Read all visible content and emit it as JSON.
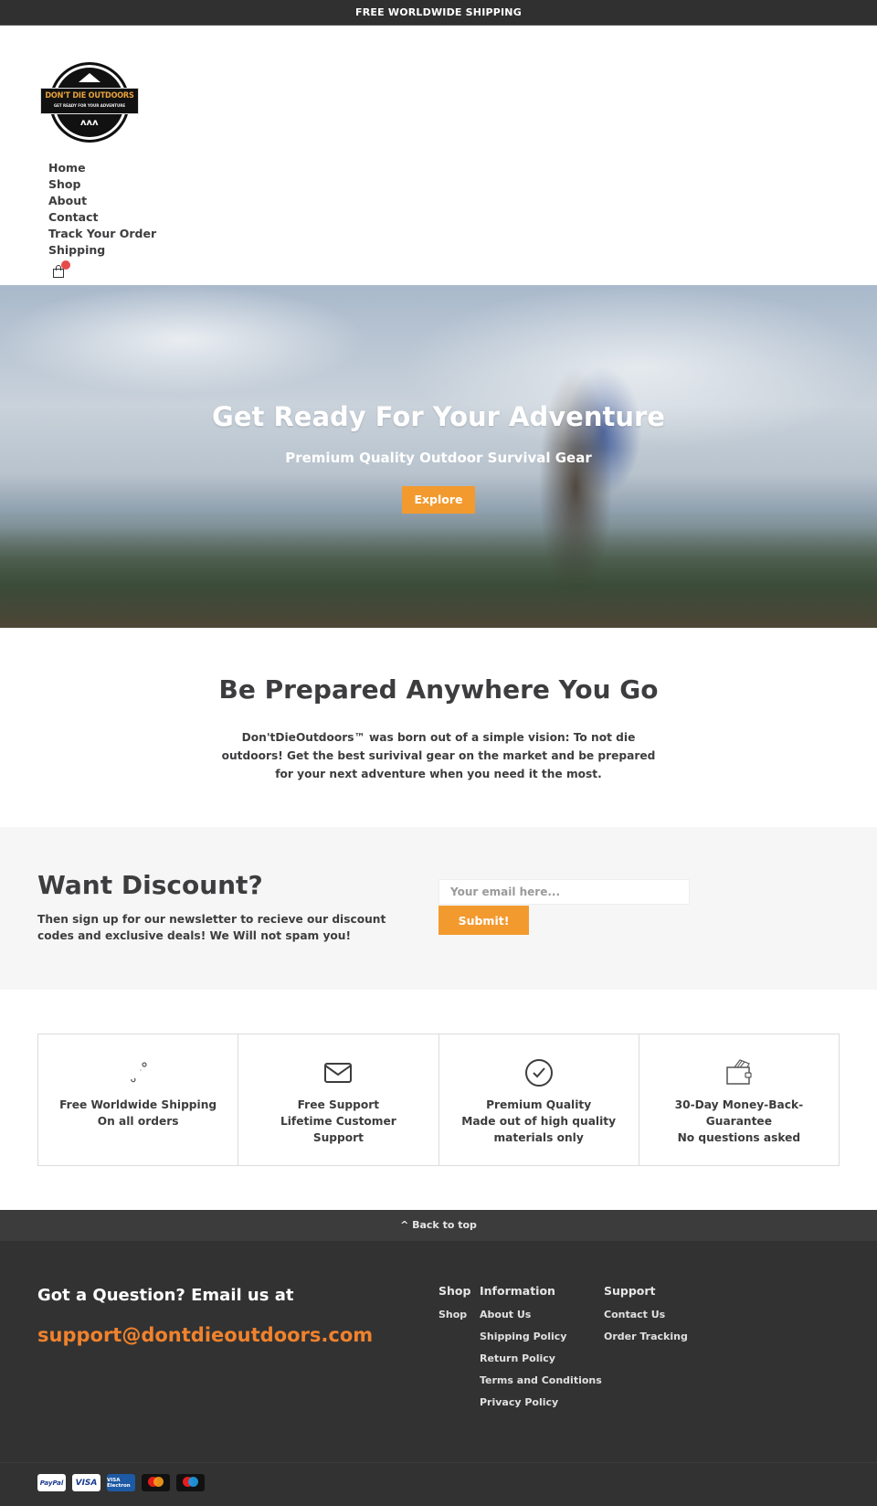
{
  "announcement": {
    "text": "FREE WORLDWIDE SHIPPING"
  },
  "logo": {
    "title": "DON'T DIE OUTDOORS",
    "tagline": "GET READY FOR YOUR ADVENTURE",
    "icon": "mountain-logo-icon"
  },
  "nav": {
    "items": [
      {
        "label": "Home"
      },
      {
        "label": "Shop"
      },
      {
        "label": "About"
      },
      {
        "label": "Contact"
      },
      {
        "label": "Track Your Order"
      },
      {
        "label": "Shipping"
      }
    ],
    "cart_icon": "shopping-bag-icon"
  },
  "hero": {
    "title": "Get Ready For Your Adventure",
    "subtitle": "Premium Quality Outdoor Survival Gear",
    "button_label": "Explore"
  },
  "about": {
    "heading": "Be Prepared Anywhere You Go",
    "text": "Don'tDieOutdoors™ was born out of a simple vision: To not die outdoors! Get the best surivival gear on the market and be prepared for your next adventure when you need it the most."
  },
  "newsletter": {
    "heading": "Want Discount?",
    "text": "Then sign up for our newsletter to recieve our discount codes and exclusive deals! We Will not spam you!",
    "email_placeholder": "Your email here...",
    "email_value": "",
    "submit_label": "Submit!"
  },
  "features": [
    {
      "icon": "shipping-icon",
      "title": "Free Worldwide Shipping",
      "lines": [
        "On all orders"
      ]
    },
    {
      "icon": "envelope-icon",
      "title": "Free Support",
      "lines": [
        "Lifetime Customer Support"
      ]
    },
    {
      "icon": "check-circle-icon",
      "title": "Premium Quality",
      "lines": [
        "Made out of high quality materials only"
      ]
    },
    {
      "icon": "wallet-icon",
      "title": "30-Day Money-Back-Guarantee",
      "lines": [
        "No questions asked"
      ]
    }
  ],
  "back_to_top": {
    "label": "^ Back to top"
  },
  "footer": {
    "question": "Got a Question? Email us at",
    "email": "support@dontdieoutdoors.com",
    "columns": [
      {
        "heading": "Shop",
        "links": [
          "Shop"
        ]
      },
      {
        "heading": "Information",
        "links": [
          "About Us",
          "Shipping Policy",
          "Return Policy",
          "Terms and Conditions",
          "Privacy Policy"
        ]
      },
      {
        "heading": "Support",
        "links": [
          "Contact Us",
          "Order Tracking"
        ]
      }
    ],
    "payment_methods": [
      "PayPal",
      "VISA",
      "VISA Electron",
      "Mastercard",
      "Maestro"
    ]
  },
  "colors": {
    "accent": "#f39a2f",
    "email_link": "#f0822d",
    "dark_bg": "#323232",
    "text": "#3d3d3f",
    "cart_badge": "#e84a4a"
  }
}
